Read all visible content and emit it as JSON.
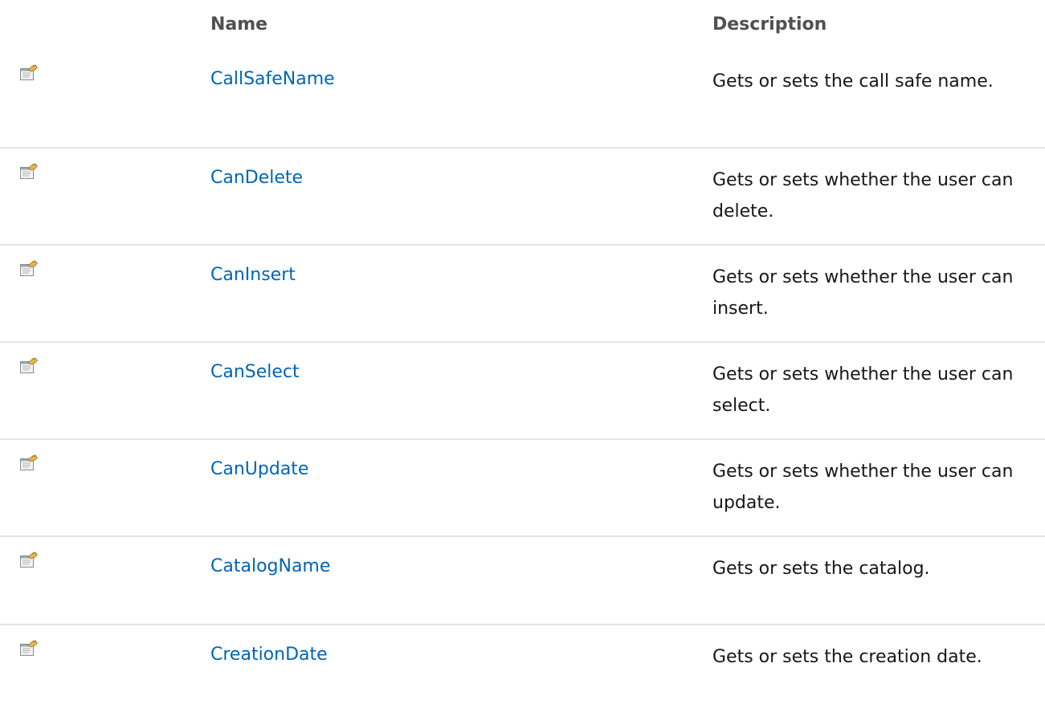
{
  "table": {
    "headers": {
      "name": "Name",
      "description": "Description"
    },
    "rows": [
      {
        "icon": "property-icon",
        "name": "CallSafeName",
        "description": "Gets or sets the call safe name."
      },
      {
        "icon": "property-icon",
        "name": "CanDelete",
        "description": "Gets or sets whether the user can delete."
      },
      {
        "icon": "property-icon",
        "name": "CanInsert",
        "description": "Gets or sets whether the user can insert."
      },
      {
        "icon": "property-icon",
        "name": "CanSelect",
        "description": "Gets or sets whether the user can select."
      },
      {
        "icon": "property-icon",
        "name": "CanUpdate",
        "description": "Gets or sets whether the user can update."
      },
      {
        "icon": "property-icon",
        "name": "CatalogName",
        "description": "Gets or sets the catalog."
      },
      {
        "icon": "property-icon",
        "name": "CreationDate",
        "description": "Gets or sets the creation date."
      }
    ]
  },
  "colors": {
    "link": "#0065b3",
    "header_text": "#505050",
    "body_text": "#171717",
    "row_divider": "#e3e3e3"
  }
}
